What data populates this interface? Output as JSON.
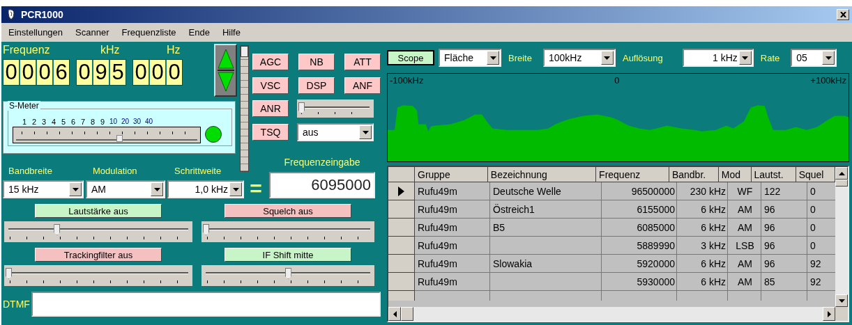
{
  "window": {
    "title": "PCR1000"
  },
  "menu": [
    "Einstellungen",
    "Scanner",
    "Frequenzliste",
    "Ende",
    "Hilfe"
  ],
  "frequency": {
    "labels": [
      "Frequenz",
      "kHz",
      "Hz"
    ],
    "groups": [
      [
        "0",
        "0",
        "0",
        "6"
      ],
      [
        "0",
        "9",
        "5"
      ],
      [
        "0",
        "0",
        "0"
      ]
    ]
  },
  "vertical_slider": {
    "level": 1
  },
  "s_meter": {
    "title": "S-Meter",
    "signal_on": true,
    "level": 0.57,
    "scale": [
      {
        "text": "1",
        "kind": "s"
      },
      {
        "text": "2",
        "kind": "s"
      },
      {
        "text": "3",
        "kind": "s"
      },
      {
        "text": "4",
        "kind": "s"
      },
      {
        "text": "5",
        "kind": "s"
      },
      {
        "text": "6",
        "kind": "s"
      },
      {
        "text": "7",
        "kind": "s"
      },
      {
        "text": "8",
        "kind": "s"
      },
      {
        "text": "9",
        "kind": "s"
      },
      {
        "text": "10",
        "kind": "db"
      },
      {
        "text": "20",
        "kind": "db"
      },
      {
        "text": "30",
        "kind": "db"
      },
      {
        "text": "40",
        "kind": "db"
      }
    ]
  },
  "function_buttons": [
    "AGC",
    "NB",
    "ATT",
    "VSC",
    "DSP",
    "ANF"
  ],
  "anr": {
    "label": "ANR",
    "level": 0
  },
  "tsq": {
    "label": "TSQ",
    "value": "aus"
  },
  "selectors": [
    {
      "label": "Bandbreite",
      "value": "15 kHz"
    },
    {
      "label": "Modulation",
      "value": "AM"
    },
    {
      "label": "Schrittweite",
      "value": "1,0 kHz"
    }
  ],
  "frequency_input": {
    "label": "Frequenzeingabe",
    "equals": "=",
    "value": "6095000"
  },
  "controls": [
    {
      "label": "Lautstärke aus",
      "color": "#c8f5c8",
      "level": 0.27
    },
    {
      "label": "Squelch aus",
      "color": "#f5c0c0",
      "level": 0
    },
    {
      "label": "Trackingfilter aus",
      "color": "#f5c0c0",
      "level": 0
    },
    {
      "label": "IF Shift mitte",
      "color": "#c8f5c8",
      "level": 0.5
    }
  ],
  "dtmf": {
    "label": "DTMF"
  },
  "scope": {
    "button": "Scope",
    "mode": "Fläche",
    "width_label": "Breite",
    "width": "100kHz",
    "resolution_label": "Auflösung",
    "resolution": "1 kHz",
    "rate_label": "Rate",
    "rate": "05",
    "axis": [
      "-100kHz",
      "0",
      "+100kHz"
    ]
  },
  "table": {
    "columns": [
      "Gruppe",
      "Bezeichnung",
      "Frequenz",
      "Bandbr.",
      "Mod",
      "Lautst.",
      "Squel"
    ],
    "rows": [
      {
        "selected": true,
        "cells": [
          "Rufu49m",
          "Deutsche Welle",
          "96500000",
          "230 kHz",
          "WF",
          "122",
          "0"
        ]
      },
      {
        "selected": false,
        "cells": [
          "Rufu49m",
          "Östreich1",
          "6155000",
          "6 kHz",
          "AM",
          "96",
          "0"
        ]
      },
      {
        "selected": false,
        "cells": [
          "Rufu49m",
          "B5",
          "6085000",
          "6 kHz",
          "AM",
          "96",
          "0"
        ]
      },
      {
        "selected": false,
        "cells": [
          "Rufu49m",
          "",
          "5889990",
          "3 kHz",
          "LSB",
          "96",
          "0"
        ]
      },
      {
        "selected": false,
        "cells": [
          "Rufu49m",
          "Slowakia",
          "5920000",
          "6 kHz",
          "AM",
          "96",
          "92"
        ]
      },
      {
        "selected": false,
        "cells": [
          "Rufu49m",
          "",
          "5930000",
          "6 kHz",
          "AM",
          "85",
          "92"
        ]
      }
    ]
  }
}
